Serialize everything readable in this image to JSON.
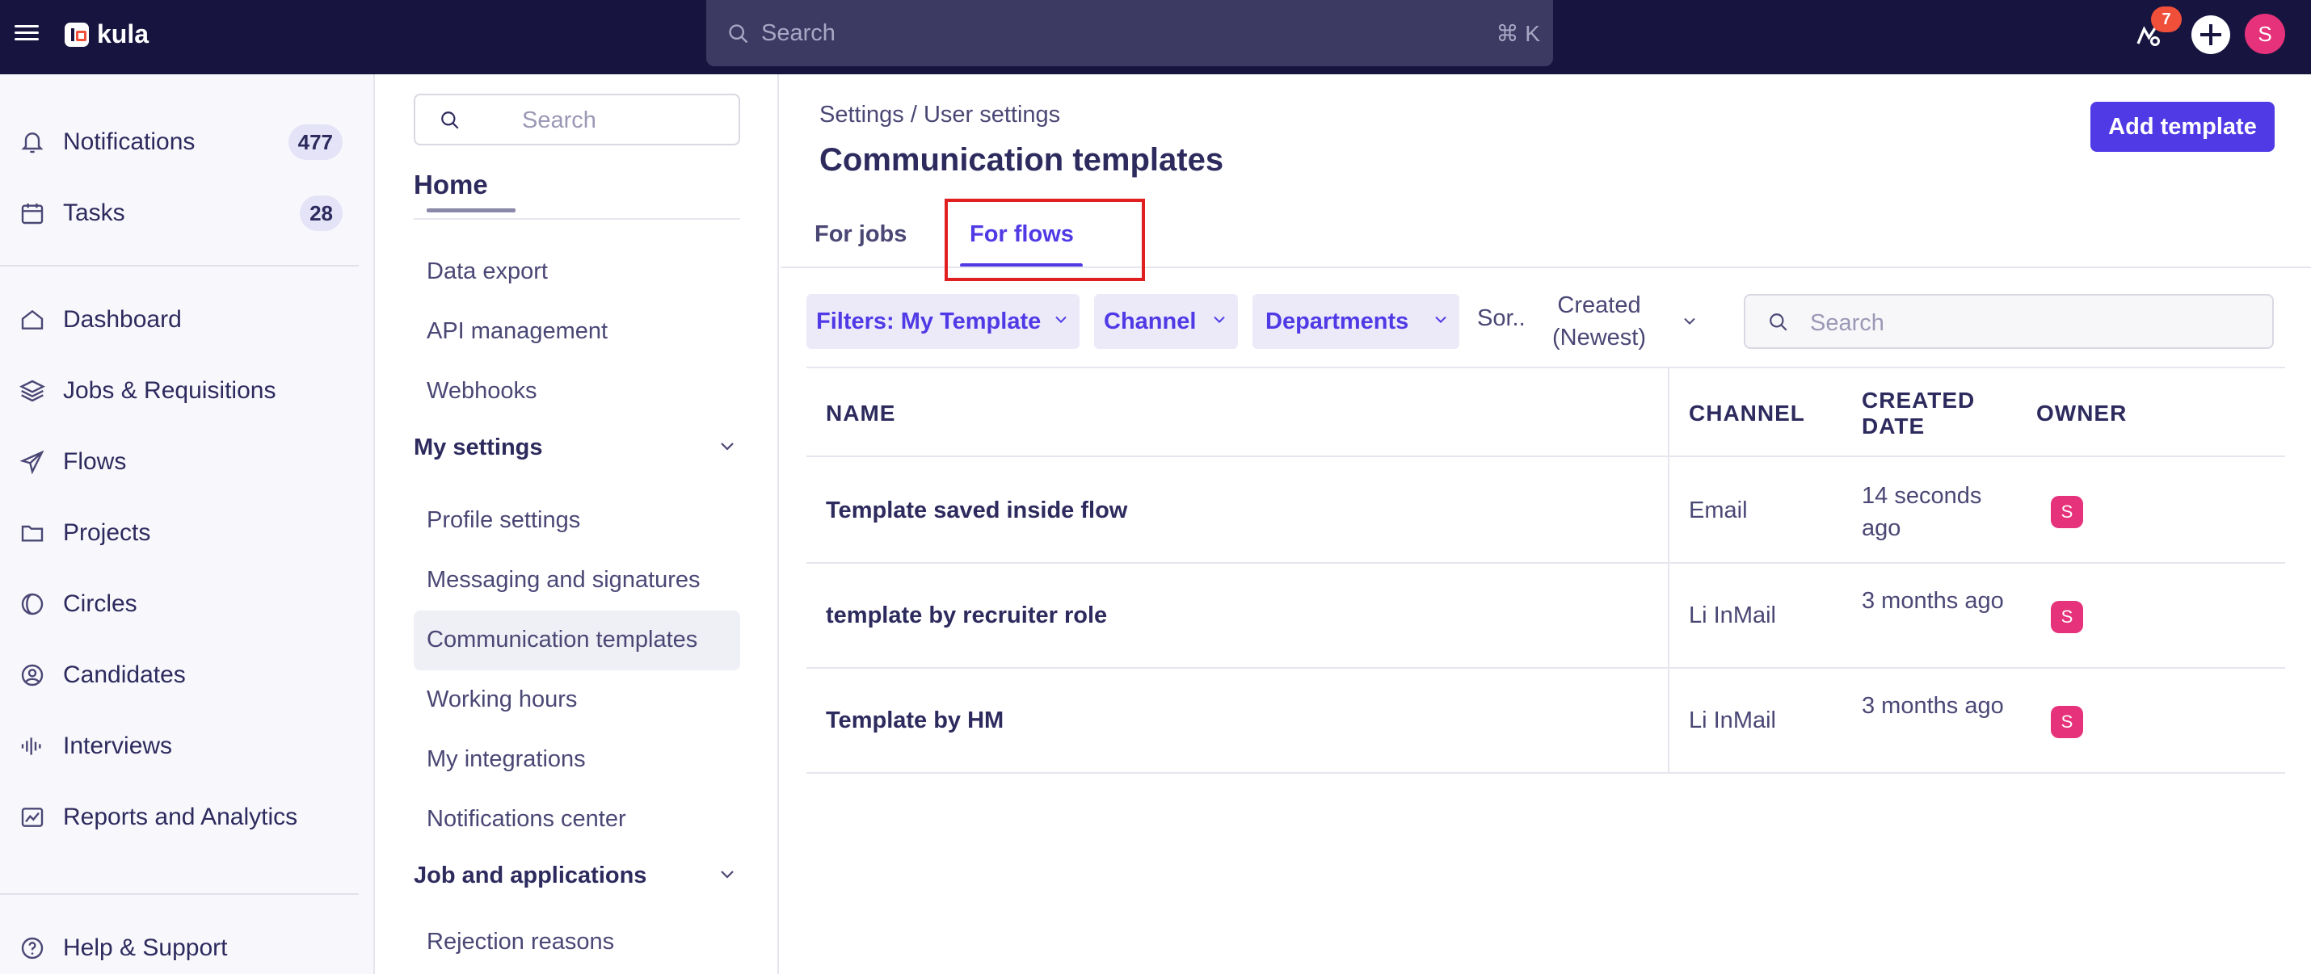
{
  "topbar": {
    "logo_text": "kula",
    "search_placeholder": "Search",
    "search_shortcut": "⌘ K",
    "notification_count": "7",
    "user_initial": "S"
  },
  "leftnav": {
    "items": [
      {
        "label": "Notifications",
        "badge": "477",
        "icon": "bell-icon"
      },
      {
        "label": "Tasks",
        "badge": "28",
        "icon": "calendar-icon"
      },
      {
        "label": "Dashboard",
        "icon": "home-icon"
      },
      {
        "label": "Jobs & Requisitions",
        "icon": "layers-icon"
      },
      {
        "label": "Flows",
        "icon": "send-icon"
      },
      {
        "label": "Projects",
        "icon": "folder-icon"
      },
      {
        "label": "Circles",
        "icon": "circles-icon"
      },
      {
        "label": "Candidates",
        "icon": "user-circle-icon"
      },
      {
        "label": "Interviews",
        "icon": "audio-wave-icon"
      },
      {
        "label": "Reports and Analytics",
        "icon": "chart-icon"
      },
      {
        "label": "Help & Support",
        "icon": "help-icon"
      }
    ]
  },
  "settings_nav": {
    "search_placeholder": "Search",
    "home_label": "Home",
    "items_top": [
      "Data export",
      "API management",
      "Webhooks"
    ],
    "section_my_settings": "My settings",
    "items_my_settings": [
      "Profile settings",
      "Messaging and signatures",
      "Communication templates",
      "Working hours",
      "My integrations",
      "Notifications center"
    ],
    "section_jobs": "Job and applications",
    "items_jobs": [
      "Rejection reasons"
    ]
  },
  "main": {
    "breadcrumb": "Settings / User settings",
    "title": "Communication templates",
    "add_button": "Add template",
    "tabs": [
      {
        "label": "For jobs",
        "active": false
      },
      {
        "label": "For flows",
        "active": true
      }
    ],
    "filters": {
      "template_filter": "Filters: My Template",
      "channel": "Channel",
      "departments": "Departments",
      "sort_short": "Sor..",
      "sort_value": "Created (Newest)",
      "search_placeholder": "Search"
    },
    "table": {
      "columns": [
        "NAME",
        "CHANNEL",
        "CREATED DATE",
        "OWNER"
      ],
      "rows": [
        {
          "name": "Template saved inside flow",
          "channel": "Email",
          "created": "14 seconds ago",
          "owner": "S"
        },
        {
          "name": "template by recruiter role",
          "channel": "Li InMail",
          "created": "3 months ago",
          "owner": "S"
        },
        {
          "name": "Template by HM",
          "channel": "Li InMail",
          "created": "3 months ago",
          "owner": "S"
        }
      ]
    }
  },
  "colors": {
    "topbar": "#17153f",
    "accent": "#4f3ae6",
    "avatar": "#e6327a",
    "badge": "#f04f3a",
    "highlight": "#e02020"
  }
}
